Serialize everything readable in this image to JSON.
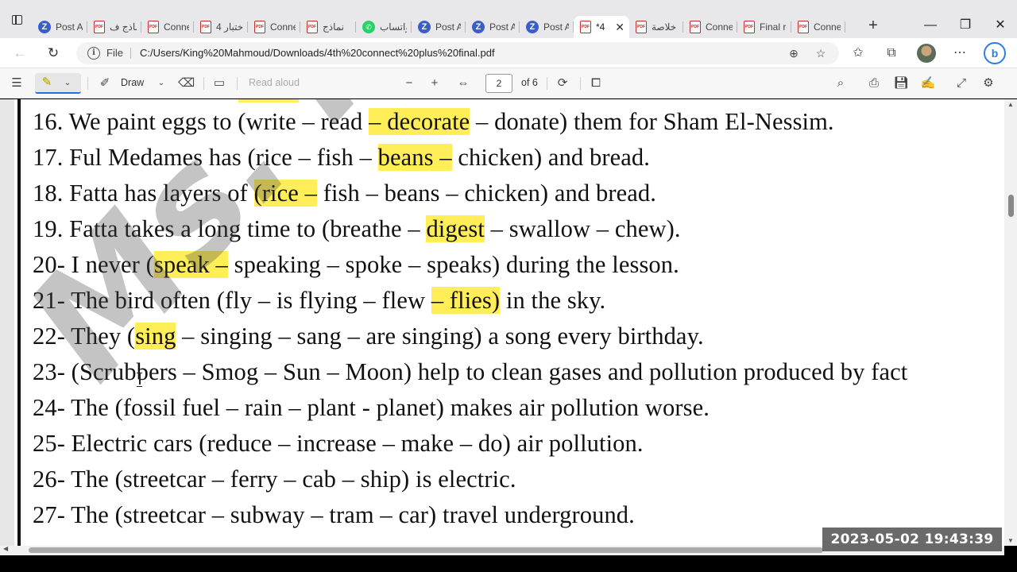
{
  "tabs": [
    {
      "icon": "z",
      "label": "Post At"
    },
    {
      "icon": "pdf",
      "label": "نماذج ف"
    },
    {
      "icon": "pdf",
      "label": "Conne"
    },
    {
      "icon": "pdf",
      "label": "اختبار 4"
    },
    {
      "icon": "pdf",
      "label": "Conne"
    },
    {
      "icon": "pdf",
      "label": "نماذج"
    },
    {
      "icon": "wa",
      "label": "واتساب"
    },
    {
      "icon": "z",
      "label": "Post At"
    },
    {
      "icon": "z",
      "label": "Post At"
    },
    {
      "icon": "z",
      "label": "Post At"
    },
    {
      "icon": "pdf",
      "label": "*4",
      "active": true
    },
    {
      "icon": "pdf",
      "label": "خلاصة"
    },
    {
      "icon": "pdf",
      "label": "Conne"
    },
    {
      "icon": "pdf",
      "label": "Final re"
    },
    {
      "icon": "pdf",
      "label": "Conne"
    }
  ],
  "address": {
    "scheme": "File",
    "url": "C:/Users/King%20Mahmoud/Downloads/4th%20connect%20plus%20final.pdf"
  },
  "pdf_toolbar": {
    "draw_label": "Draw",
    "read_aloud_label": "Read aloud",
    "page_current": "2",
    "page_total": "of 6"
  },
  "document": {
    "lines": [
      [
        {
          "t": "16. We paint eggs to (write – read "
        },
        {
          "t": "– decorate",
          "hl": true
        },
        {
          "t": " – donate) them for Sham El-Nessim."
        }
      ],
      [
        {
          "t": "17. Ful Medames has (rice – fish – "
        },
        {
          "t": "beans –",
          "hl": true
        },
        {
          "t": " chicken) and bread."
        }
      ],
      [
        {
          "t": "18. Fatta has layers of "
        },
        {
          "t": "(rice –",
          "hl": true
        },
        {
          "t": " fish – beans – chicken) and bread."
        }
      ],
      [
        {
          "t": "19. Fatta takes a long time to (breathe – "
        },
        {
          "t": "digest",
          "hl": true
        },
        {
          "t": " – swallow – chew)."
        }
      ],
      [
        {
          "t": "20- I never ("
        },
        {
          "t": "speak –",
          "hl": true
        },
        {
          "t": " speaking – spoke – speaks) during the lesson."
        }
      ],
      [
        {
          "t": "21- The bird often (fly – is flying – flew "
        },
        {
          "t": "– flies)",
          "hl": true
        },
        {
          "t": " in the sky."
        }
      ],
      [
        {
          "t": "22- They ("
        },
        {
          "t": "sing",
          "hl": true
        },
        {
          "t": " – singing – sang – are singing) a song every birthday."
        }
      ],
      [
        {
          "t": "23- (Scrubbers – Smog – Sun – Moon) help to clean gases and pollution produced by fact"
        }
      ],
      [
        {
          "t": "24- The (fossil fuel – rain – plant - planet) makes air pollution worse."
        }
      ],
      [
        {
          "t": "25- Electric cars (reduce – increase – make – do) air pollution."
        }
      ],
      [
        {
          "t": "26- The (streetcar – ferry – cab – ship) is electric."
        }
      ],
      [
        {
          "t": "27- The (streetcar – subway – tram – car) travel underground."
        }
      ]
    ],
    "watermark": "Ms. Imam"
  },
  "overlay": {
    "timestamp": "2023-05-02  19:43:39"
  },
  "colors": {
    "highlight": "#ffee58",
    "accent": "#1a73e8"
  }
}
